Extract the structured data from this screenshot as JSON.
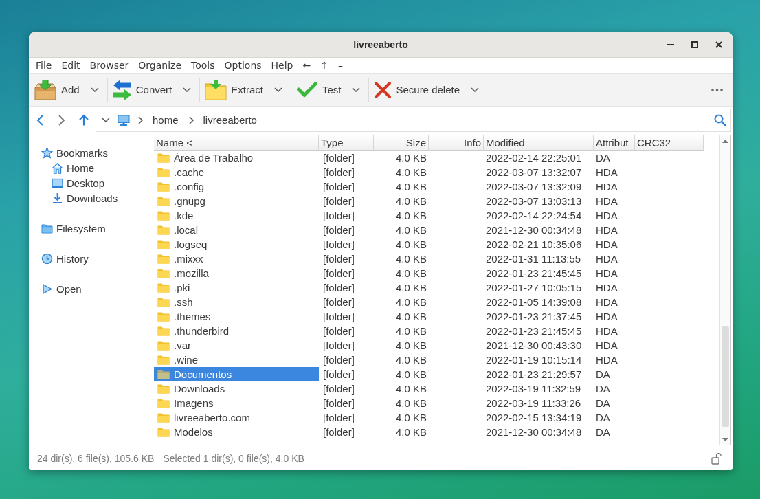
{
  "window": {
    "title": "livreeaberto"
  },
  "menu": [
    "File",
    "Edit",
    "Browser",
    "Organize",
    "Tools",
    "Options",
    "Help",
    "←",
    "↑",
    "–"
  ],
  "toolbar": {
    "buttons": [
      {
        "kind": "add",
        "label": "Add"
      },
      {
        "kind": "convert",
        "label": "Convert"
      },
      {
        "kind": "extract",
        "label": "Extract"
      },
      {
        "kind": "test",
        "label": "Test"
      },
      {
        "kind": "delete",
        "label": "Secure delete"
      }
    ]
  },
  "navigation": [
    {
      "kind": "back",
      "disabled": false
    },
    {
      "kind": "forward",
      "disabled": true
    },
    {
      "kind": "up",
      "disabled": false
    }
  ],
  "path": {
    "segments": [
      "home",
      "livreeaberto"
    ]
  },
  "sidebar": {
    "items": [
      {
        "kind": "bookmarks",
        "label": "Bookmarks",
        "children": [
          {
            "kind": "home",
            "label": "Home"
          },
          {
            "kind": "desktop",
            "label": "Desktop"
          },
          {
            "kind": "downloads",
            "label": "Downloads"
          }
        ]
      },
      {
        "kind": "filesystem",
        "label": "Filesystem"
      },
      {
        "kind": "history",
        "label": "History"
      },
      {
        "kind": "open",
        "label": "Open"
      }
    ]
  },
  "table": {
    "columns": [
      "Name <",
      "Type",
      "Size",
      "Info",
      "Modified",
      "Attribut",
      "CRC32"
    ],
    "rows": [
      {
        "name": "Área de Trabalho",
        "type": "[folder]",
        "size": "4.0 KB",
        "modified": "2022-02-14 22:25:01",
        "attributes": "DA",
        "selected": false
      },
      {
        "name": ".cache",
        "type": "[folder]",
        "size": "4.0 KB",
        "modified": "2022-03-07 13:32:07",
        "attributes": "HDA",
        "selected": false
      },
      {
        "name": ".config",
        "type": "[folder]",
        "size": "4.0 KB",
        "modified": "2022-03-07 13:32:09",
        "attributes": "HDA",
        "selected": false
      },
      {
        "name": ".gnupg",
        "type": "[folder]",
        "size": "4.0 KB",
        "modified": "2022-03-07 13:03:13",
        "attributes": "HDA",
        "selected": false
      },
      {
        "name": ".kde",
        "type": "[folder]",
        "size": "4.0 KB",
        "modified": "2022-02-14 22:24:54",
        "attributes": "HDA",
        "selected": false
      },
      {
        "name": ".local",
        "type": "[folder]",
        "size": "4.0 KB",
        "modified": "2021-12-30 00:34:48",
        "attributes": "HDA",
        "selected": false
      },
      {
        "name": ".logseq",
        "type": "[folder]",
        "size": "4.0 KB",
        "modified": "2022-02-21 10:35:06",
        "attributes": "HDA",
        "selected": false
      },
      {
        "name": ".mixxx",
        "type": "[folder]",
        "size": "4.0 KB",
        "modified": "2022-01-31 11:13:55",
        "attributes": "HDA",
        "selected": false
      },
      {
        "name": ".mozilla",
        "type": "[folder]",
        "size": "4.0 KB",
        "modified": "2022-01-23 21:45:45",
        "attributes": "HDA",
        "selected": false
      },
      {
        "name": ".pki",
        "type": "[folder]",
        "size": "4.0 KB",
        "modified": "2022-01-27 10:05:15",
        "attributes": "HDA",
        "selected": false
      },
      {
        "name": ".ssh",
        "type": "[folder]",
        "size": "4.0 KB",
        "modified": "2022-01-05 14:39:08",
        "attributes": "HDA",
        "selected": false
      },
      {
        "name": ".themes",
        "type": "[folder]",
        "size": "4.0 KB",
        "modified": "2022-01-23 21:37:45",
        "attributes": "HDA",
        "selected": false
      },
      {
        "name": ".thunderbird",
        "type": "[folder]",
        "size": "4.0 KB",
        "modified": "2022-01-23 21:45:45",
        "attributes": "HDA",
        "selected": false
      },
      {
        "name": ".var",
        "type": "[folder]",
        "size": "4.0 KB",
        "modified": "2021-12-30 00:43:30",
        "attributes": "HDA",
        "selected": false
      },
      {
        "name": ".wine",
        "type": "[folder]",
        "size": "4.0 KB",
        "modified": "2022-01-19 10:15:14",
        "attributes": "HDA",
        "selected": false
      },
      {
        "name": "Documentos",
        "type": "[folder]",
        "size": "4.0 KB",
        "modified": "2022-01-23 21:29:57",
        "attributes": "DA",
        "selected": true
      },
      {
        "name": "Downloads",
        "type": "[folder]",
        "size": "4.0 KB",
        "modified": "2022-03-19 11:32:59",
        "attributes": "DA",
        "selected": false
      },
      {
        "name": "Imagens",
        "type": "[folder]",
        "size": "4.0 KB",
        "modified": "2022-03-19 11:33:26",
        "attributes": "DA",
        "selected": false
      },
      {
        "name": "livreeaberto.com",
        "type": "[folder]",
        "size": "4.0 KB",
        "modified": "2022-02-15 13:34:19",
        "attributes": "DA",
        "selected": false
      },
      {
        "name": "Modelos",
        "type": "[folder]",
        "size": "4.0 KB",
        "modified": "2021-12-30 00:34:48",
        "attributes": "DA",
        "selected": false
      }
    ]
  },
  "status_bar": {
    "summary": "24 dir(s), 6 file(s), 105.6 KB",
    "selection": "Selected 1 dir(s), 0 file(s), 4.0 KB"
  }
}
